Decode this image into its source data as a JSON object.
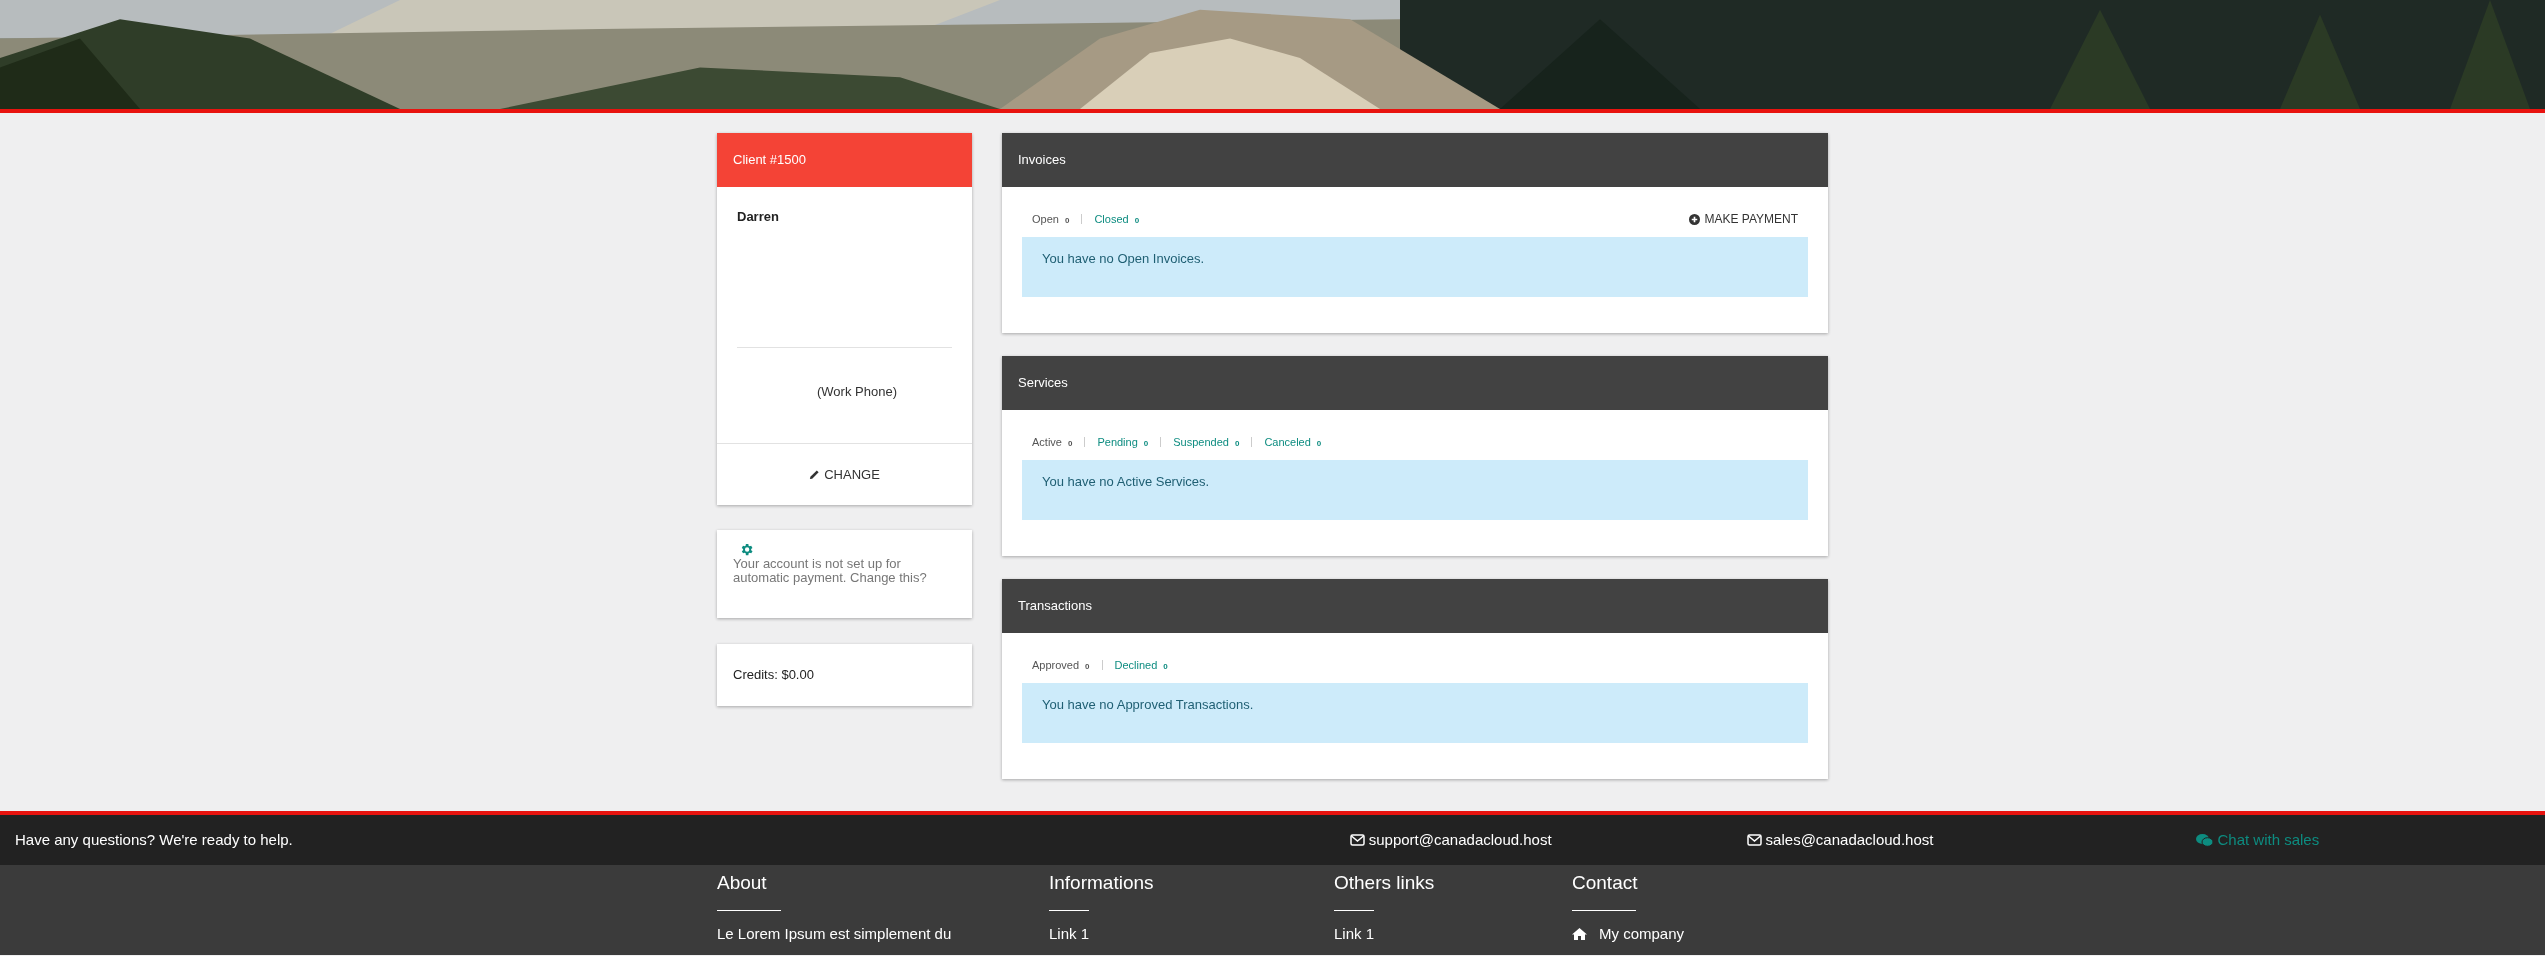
{
  "client": {
    "title": "Client #1500",
    "name": "Darren",
    "phone_label": "(Work Phone)",
    "change_button": "CHANGE"
  },
  "autopay": {
    "message": "Your account is not set up for automatic payment. Change this?"
  },
  "credits": {
    "text": "Credits: $0.00"
  },
  "panels": [
    {
      "title": "Invoices",
      "tabs": [
        {
          "label": "Open",
          "count": "0",
          "selected": true
        },
        {
          "label": "Closed",
          "count": "0",
          "selected": false
        }
      ],
      "action": "MAKE PAYMENT",
      "notice": "You have no Open Invoices."
    },
    {
      "title": "Services",
      "tabs": [
        {
          "label": "Active",
          "count": "0",
          "selected": true
        },
        {
          "label": "Pending",
          "count": "0",
          "selected": false
        },
        {
          "label": "Suspended",
          "count": "0",
          "selected": false
        },
        {
          "label": "Canceled",
          "count": "0",
          "selected": false
        }
      ],
      "notice": "You have no Active Services."
    },
    {
      "title": "Transactions",
      "tabs": [
        {
          "label": "Approved",
          "count": "0",
          "selected": true
        },
        {
          "label": "Declined",
          "count": "0",
          "selected": false
        }
      ],
      "notice": "You have no Approved Transactions."
    }
  ],
  "footer_bar": {
    "question": "Have any questions? We're ready to help.",
    "support_email": "support@canadacloud.host",
    "sales_email": "sales@canadacloud.host",
    "chat": "Chat with sales"
  },
  "footer_columns": [
    {
      "heading": "About",
      "items": [
        {
          "kind": "text",
          "text": "Le Lorem Ipsum est simplement du"
        }
      ]
    },
    {
      "heading": "Informations",
      "items": [
        {
          "kind": "link",
          "text": "Link 1"
        }
      ]
    },
    {
      "heading": "Others links",
      "items": [
        {
          "kind": "link",
          "text": "Link 1"
        }
      ]
    },
    {
      "heading": "Contact",
      "items": [
        {
          "kind": "home",
          "text": "My company"
        }
      ]
    }
  ]
}
